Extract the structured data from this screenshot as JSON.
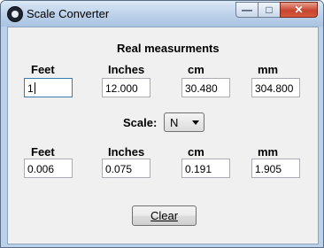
{
  "window": {
    "title": "Scale Converter",
    "icon": "paw-icon"
  },
  "controls": {
    "minimize": "—",
    "maximize": "□",
    "close": "✕"
  },
  "real": {
    "heading": "Real measurments",
    "labels": [
      "Feet",
      "Inches",
      "cm",
      "mm"
    ],
    "values": [
      "1",
      "12.000",
      "30.480",
      "304.800"
    ]
  },
  "scale": {
    "label": "Scale:",
    "selected": "N"
  },
  "scaled": {
    "labels": [
      "Feet",
      "Inches",
      "cm",
      "mm"
    ],
    "values": [
      "0.006",
      "0.075",
      "0.191",
      "1.905"
    ]
  },
  "clear_button": {
    "label": "Clear"
  }
}
